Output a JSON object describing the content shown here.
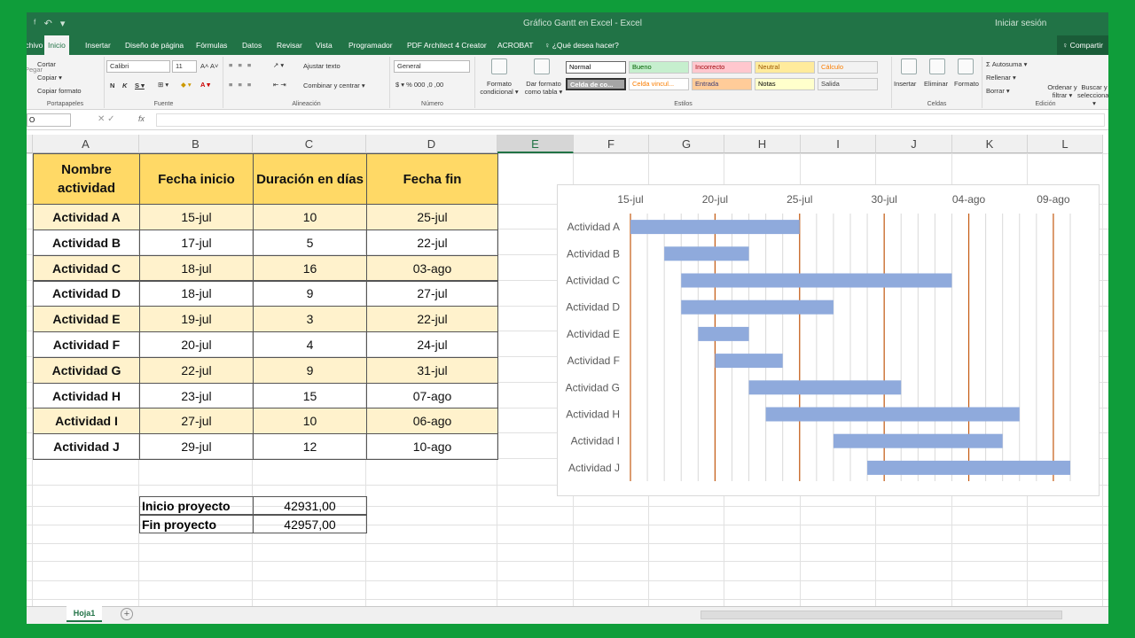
{
  "titlebar": {
    "qat": "ᶠ ↶ ▾",
    "title": "Gráfico Gantt en Excel - Excel",
    "user": "Iniciar sesión"
  },
  "tabs": [
    {
      "label": "Archivo"
    },
    {
      "label": "Inicio"
    },
    {
      "label": "Insertar"
    },
    {
      "label": "Diseño de página"
    },
    {
      "label": "Fórmulas"
    },
    {
      "label": "Datos"
    },
    {
      "label": "Revisar"
    },
    {
      "label": "Vista"
    },
    {
      "label": "Programador"
    },
    {
      "label": "PDF Architect 4 Creator"
    },
    {
      "label": "ACROBAT"
    },
    {
      "label": "♀ ¿Qué desea hacer?"
    }
  ],
  "share": "♀ Compartir",
  "ribbon": {
    "clipboard": {
      "cut": "Cortar",
      "copy": "Copiar ▾",
      "format_painter": "Copiar formato",
      "paste": "Pegar",
      "label": "Portapapeles"
    },
    "font": {
      "name": "Calibri",
      "size": "11",
      "label": "Fuente",
      "bold": "N",
      "italic": "K",
      "underline": "S ▾"
    },
    "alignment": {
      "wrap": "Ajustar texto",
      "merge": "Combinar y centrar ▾",
      "label": "Alineación"
    },
    "number": {
      "format": "General",
      "label": "Número"
    },
    "styles": {
      "conditional": "Formato condicional ▾",
      "table": "Dar formato como tabla ▾",
      "label": "Estilos",
      "cells": [
        {
          "label": "Normal",
          "bg": "#ffffff",
          "fg": "#000000"
        },
        {
          "label": "Bueno",
          "bg": "#c6efce",
          "fg": "#006100"
        },
        {
          "label": "Incorrecto",
          "bg": "#ffc7ce",
          "fg": "#9c0006"
        },
        {
          "label": "Neutral",
          "bg": "#ffeb9c",
          "fg": "#9c5700"
        },
        {
          "label": "Cálculo",
          "bg": "#f2f2f2",
          "fg": "#fa7d00"
        },
        {
          "label": "Celda de co...",
          "bg": "#a5a5a5",
          "fg": "#ffffff"
        },
        {
          "label": "Celda vincul...",
          "bg": "#ffffff",
          "fg": "#fa7d00"
        },
        {
          "label": "Entrada",
          "bg": "#ffcc99",
          "fg": "#3f3f76"
        },
        {
          "label": "Notas",
          "bg": "#ffffcc",
          "fg": "#000000"
        },
        {
          "label": "Salida",
          "bg": "#f2f2f2",
          "fg": "#3f3f3f"
        }
      ]
    },
    "cells": {
      "insert": "Insertar",
      "delete": "Eliminar",
      "format": "Formato",
      "label": "Celdas"
    },
    "editing": {
      "autosum": "Σ Autosuma ▾",
      "fill": "Rellenar ▾",
      "clear": "Borrar ▾",
      "sort": "Ordenar y filtrar ▾",
      "find": "Buscar y seleccionar ▾",
      "label": "Edición"
    }
  },
  "formula_bar": {
    "name_box": "O",
    "fx": "fx",
    "content": ""
  },
  "columns": [
    "A",
    "B",
    "C",
    "D",
    "E",
    "F",
    "G",
    "H",
    "I",
    "J",
    "K",
    "L"
  ],
  "table": {
    "headers": [
      "Nombre actividad",
      "Fecha inicio",
      "Duración en días",
      "Fecha fin"
    ],
    "rows": [
      [
        "Actividad A",
        "15-jul",
        "10",
        "25-jul"
      ],
      [
        "Actividad B",
        "17-jul",
        "5",
        "22-jul"
      ],
      [
        "Actividad C",
        "18-jul",
        "16",
        "03-ago"
      ],
      [
        "Actividad D",
        "18-jul",
        "9",
        "27-jul"
      ],
      [
        "Actividad E",
        "19-jul",
        "3",
        "22-jul"
      ],
      [
        "Actividad F",
        "20-jul",
        "4",
        "24-jul"
      ],
      [
        "Actividad G",
        "22-jul",
        "9",
        "31-jul"
      ],
      [
        "Actividad H",
        "23-jul",
        "15",
        "07-ago"
      ],
      [
        "Actividad I",
        "27-jul",
        "10",
        "06-ago"
      ],
      [
        "Actividad J",
        "29-jul",
        "12",
        "10-ago"
      ]
    ]
  },
  "summary": [
    {
      "label": "Inicio proyecto",
      "value": "42931,00"
    },
    {
      "label": "Fin proyecto",
      "value": "42957,00"
    }
  ],
  "sheet_tab": "Hoja1",
  "chart_data": {
    "type": "bar",
    "orientation": "horizontal",
    "x_ticks": [
      "15-jul",
      "20-jul",
      "25-jul",
      "30-jul",
      "04-ago",
      "09-ago"
    ],
    "xlim": [
      "15-jul",
      "10-ago"
    ],
    "categories": [
      "Actividad A",
      "Actividad B",
      "Actividad C",
      "Actividad D",
      "Actividad E",
      "Actividad F",
      "Actividad G",
      "Actividad H",
      "Actividad I",
      "Actividad J"
    ],
    "start": [
      "15-jul",
      "17-jul",
      "18-jul",
      "18-jul",
      "19-jul",
      "20-jul",
      "22-jul",
      "23-jul",
      "27-jul",
      "29-jul"
    ],
    "duration": [
      10,
      5,
      16,
      9,
      3,
      4,
      9,
      15,
      10,
      12
    ],
    "bar_color": "#8faadc",
    "major_gridline_color": "#c55a11",
    "grid": true
  }
}
